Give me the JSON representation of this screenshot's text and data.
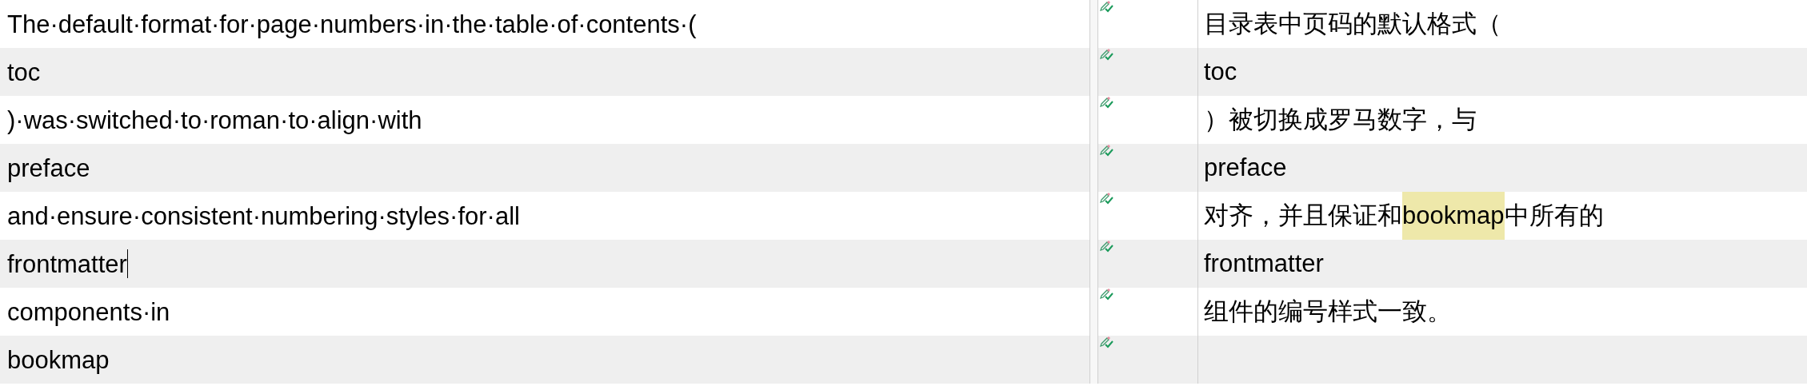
{
  "rows": [
    {
      "source": "The·default·format·for·page·numbers·in·the·table·of·contents·(",
      "caret": false,
      "target": [
        {
          "text": "目录表中页码的默认格式（",
          "highlighted": false
        }
      ]
    },
    {
      "source": "toc",
      "caret": false,
      "target": [
        {
          "text": "toc",
          "highlighted": false
        }
      ]
    },
    {
      "source": ")·was·switched·to·roman·to·align·with",
      "caret": false,
      "target": [
        {
          "text": "）被切换成罗马数字，与",
          "highlighted": false
        }
      ]
    },
    {
      "source": "preface",
      "caret": false,
      "target": [
        {
          "text": "preface",
          "highlighted": false
        }
      ]
    },
    {
      "source": "and·ensure·consistent·numbering·styles·for·all",
      "caret": false,
      "target": [
        {
          "text": "对齐，并且保证和",
          "highlighted": false
        },
        {
          "text": "bookmap",
          "highlighted": true
        },
        {
          "text": "中所有的",
          "highlighted": false
        }
      ]
    },
    {
      "source": "frontmatter",
      "caret": true,
      "target": [
        {
          "text": "frontmatter",
          "highlighted": false
        }
      ]
    },
    {
      "source": "components·in",
      "caret": false,
      "target": [
        {
          "text": "组件的编号样式一致。",
          "highlighted": false
        }
      ]
    },
    {
      "source": "bookmap",
      "caret": false,
      "target": []
    }
  ]
}
